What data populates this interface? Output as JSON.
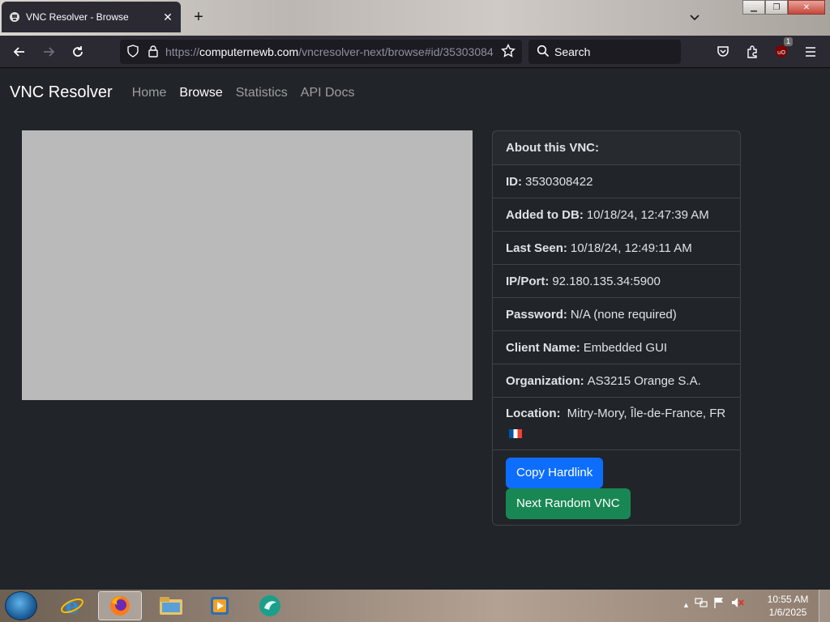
{
  "browser": {
    "tab_title": "VNC Resolver - Browse",
    "url_prefix": "https://",
    "url_host": "computernewb.com",
    "url_path": "/vncresolver-next/browse#id/35303084",
    "search_placeholder": "Search",
    "extension_badge": "1"
  },
  "site": {
    "brand": "VNC Resolver",
    "nav": [
      "Home",
      "Browse",
      "Statistics",
      "API Docs"
    ],
    "active_nav": "Browse"
  },
  "details": {
    "header": "About this VNC:",
    "id_label": "ID:",
    "id_value": "3530308422",
    "added_label": "Added to DB:",
    "added_value": "10/18/24, 12:47:39 AM",
    "seen_label": "Last Seen:",
    "seen_value": "10/18/24, 12:49:11 AM",
    "ipport_label": "IP/Port:",
    "ipport_value": "92.180.135.34:5900",
    "password_label": "Password:",
    "password_value": "N/A (none required)",
    "client_label": "Client Name:",
    "client_value": "Embedded GUI",
    "org_label": "Organization:",
    "org_value": "AS3215 Orange S.A.",
    "location_label": "Location:",
    "location_value": "Mitry-Mory, Île-de-France, FR"
  },
  "actions": {
    "copy_hardlink": "Copy Hardlink",
    "next_random": "Next Random VNC"
  },
  "taskbar": {
    "time": "10:55 AM",
    "date": "1/6/2025"
  },
  "colors": {
    "page_bg": "#212529",
    "primary": "#0d6efd",
    "success": "#198754",
    "preview": "#bababa"
  }
}
